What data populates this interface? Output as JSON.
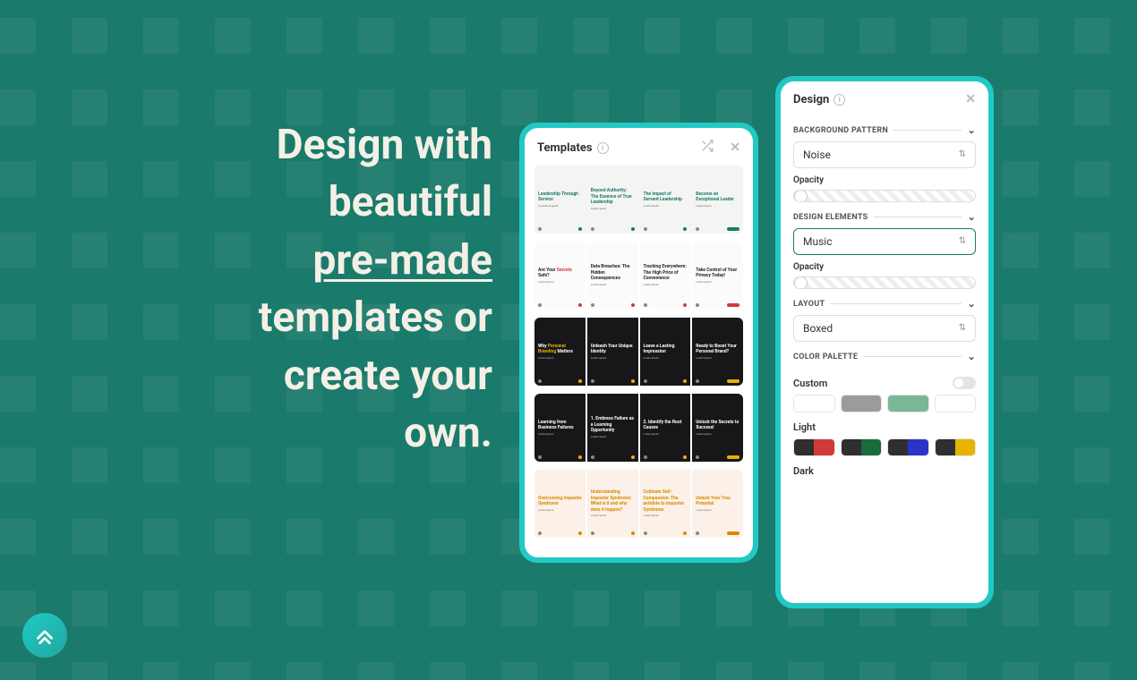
{
  "headline": {
    "line1": "Design with",
    "line2": "beautiful",
    "line3_underlined": "pre-made",
    "line4": "templates or",
    "line5": "create your",
    "line6": "own."
  },
  "templates_panel": {
    "title": "Templates",
    "rows": [
      {
        "style": "light",
        "accent": "#1a7a6b",
        "cards": [
          {
            "title": "Leadership Through Service",
            "sub": "A practical guide"
          },
          {
            "title": "Beyond Authority: The Essence of True Leadership",
            "sub": ""
          },
          {
            "title": "The Impact of Servant Leadership",
            "sub": ""
          },
          {
            "title": "Become an Exceptional Leader",
            "sub": ""
          }
        ]
      },
      {
        "style": "white",
        "accent": "#d13a3a",
        "cards": [
          {
            "title": "Are Your Secrets Safe?",
            "sub": ""
          },
          {
            "title": "Data Breaches: The Hidden Consequences",
            "sub": ""
          },
          {
            "title": "Tracking Everywhere: The High Price of Convenience",
            "sub": ""
          },
          {
            "title": "Take Control of Your Privacy Today!",
            "sub": ""
          }
        ]
      },
      {
        "style": "dark",
        "accent": "#e7b200",
        "cards": [
          {
            "title": "Why Personal Branding Matters",
            "sub": ""
          },
          {
            "title": "Unleash Your Unique Identity",
            "sub": ""
          },
          {
            "title": "Leave a Lasting Impression",
            "sub": ""
          },
          {
            "title": "Ready to Boost Your Personal Brand?",
            "sub": ""
          }
        ]
      },
      {
        "style": "dark",
        "accent": "#e7b200",
        "cards": [
          {
            "title": "Learning from Business Failures",
            "sub": ""
          },
          {
            "title": "1. Embrace Failure as a Learning Opportunity",
            "sub": ""
          },
          {
            "title": "2. Identify the Root Causes",
            "sub": ""
          },
          {
            "title": "Unlock the Secrets to Success!",
            "sub": ""
          }
        ]
      },
      {
        "style": "peach",
        "accent": "#d98a00",
        "cards": [
          {
            "title": "Overcoming Imposter Syndrome",
            "sub": ""
          },
          {
            "title": "Understanding Imposter Syndrome: What is it and why does it happen?",
            "sub": ""
          },
          {
            "title": "Cultivate Self-Compassion: The antidote to Imposter Syndrome",
            "sub": ""
          },
          {
            "title": "Unlock Your True Potential",
            "sub": ""
          }
        ]
      }
    ]
  },
  "design_panel": {
    "title": "Design",
    "sections": {
      "background_pattern": {
        "label": "BACKGROUND PATTERN",
        "value": "Noise",
        "opacity_label": "Opacity"
      },
      "design_elements": {
        "label": "DESIGN ELEMENTS",
        "value": "Music",
        "opacity_label": "Opacity"
      },
      "layout": {
        "label": "LAYOUT",
        "value": "Boxed"
      },
      "color_palette": {
        "label": "COLOR PALETTE",
        "custom_label": "Custom",
        "custom_swatches": [
          "#ffffff",
          "#9b9b9b",
          "#7ab794",
          "#ffffff"
        ],
        "light_label": "Light",
        "light_palettes": [
          [
            "#2f2f2f",
            "#d23a3a"
          ],
          [
            "#2f2f2f",
            "#1a6b3a"
          ],
          [
            "#2f2f2f",
            "#2a34c9"
          ],
          [
            "#2f2f2f",
            "#e7b200"
          ]
        ],
        "dark_label": "Dark"
      }
    }
  }
}
